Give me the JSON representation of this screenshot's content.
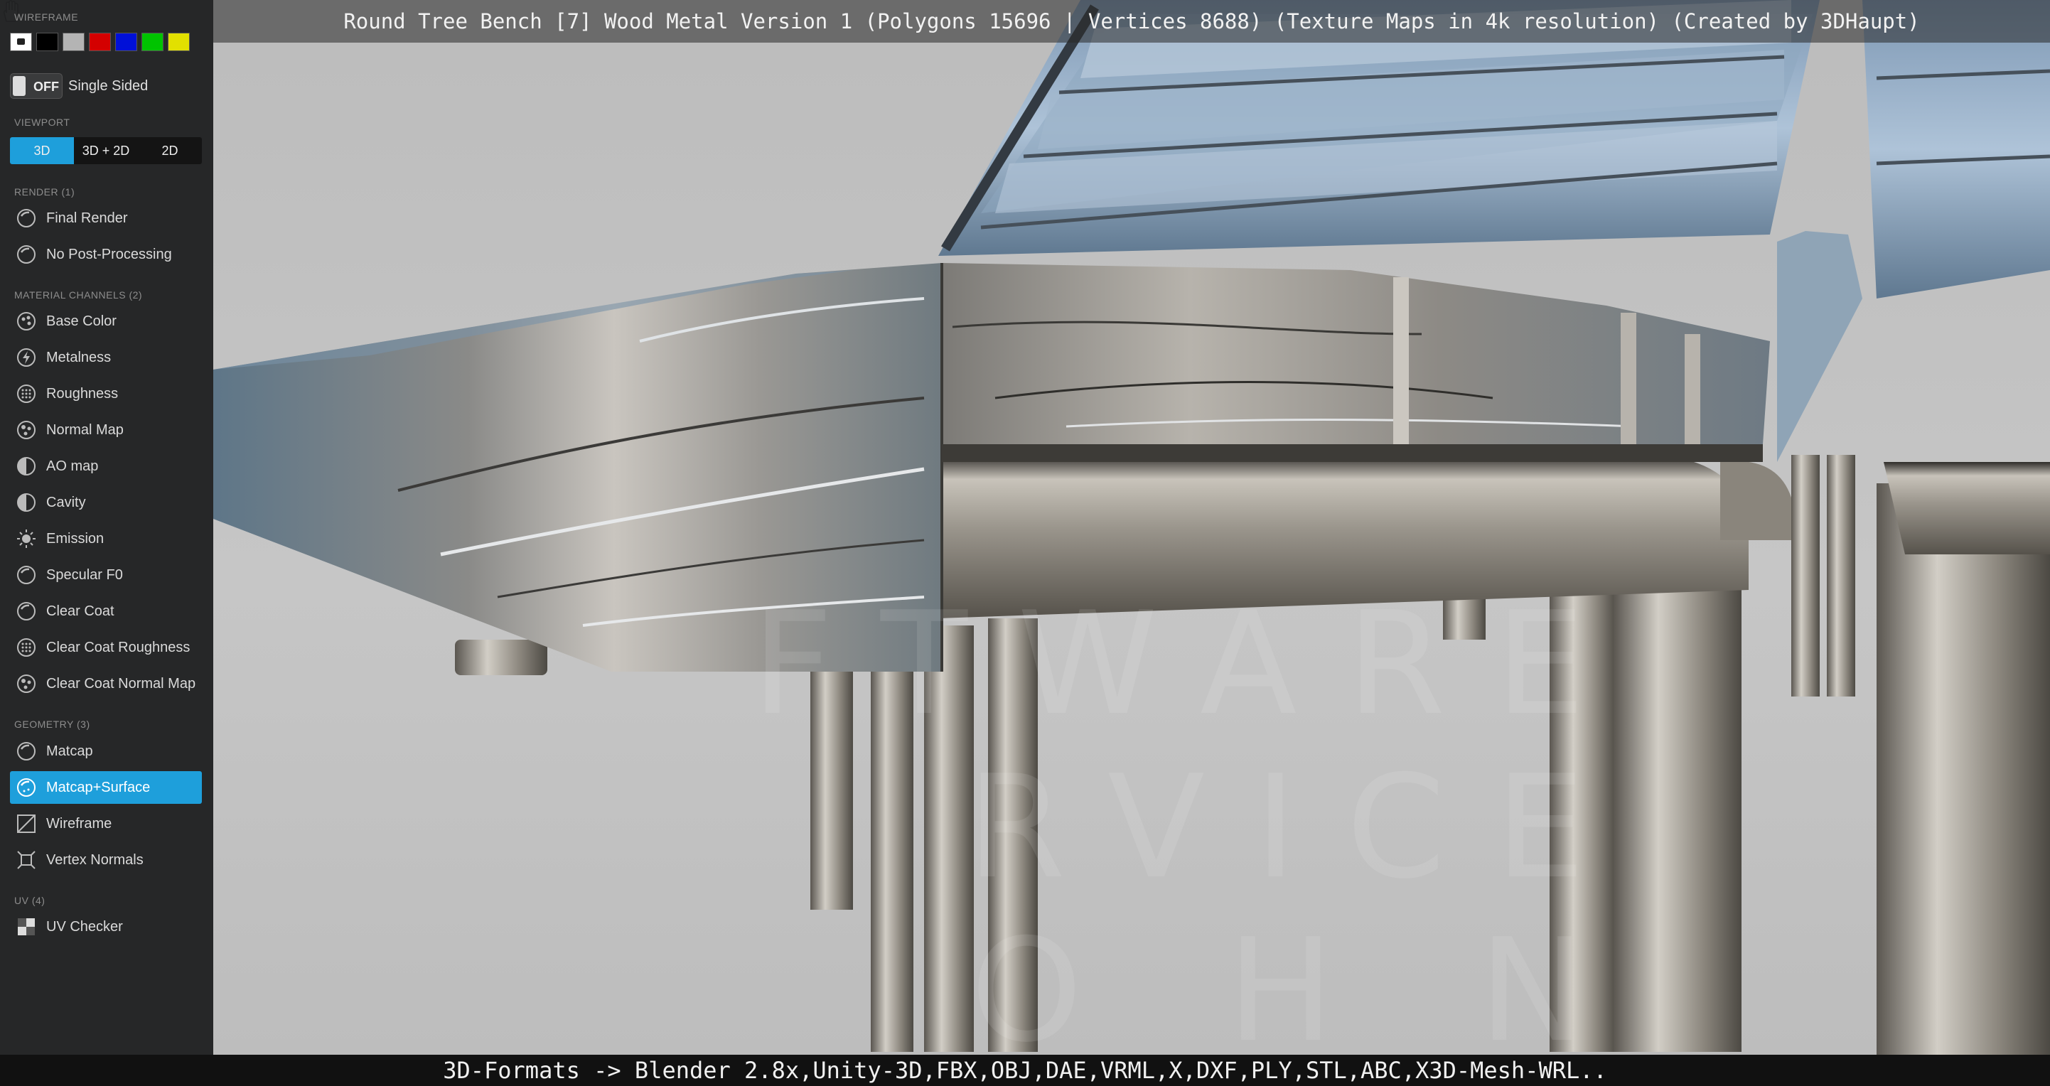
{
  "title": "Round Tree Bench [7] Wood Metal Version 1 (Polygons 15696 | Vertices 8688) (Texture Maps in 4k resolution) (Created by 3DHaupt)",
  "footer": "3D-Formats -> Blender 2.8x,Unity-3D,FBX,OBJ,DAE,VRML,X,DXF,PLY,STL,ABC,X3D-Mesh-WRL..",
  "watermark_lines": [
    "FTWARE",
    "RVICE",
    "O H N"
  ],
  "sidebar": {
    "wireframe_label": "WIREFRAME",
    "swatch_colors": [
      "#ffffff",
      "#000000",
      "#b4b4b4",
      "#d40000",
      "#0010d8",
      "#00c400",
      "#e2e000"
    ],
    "toggle": {
      "state": "OFF",
      "label": "Single Sided"
    },
    "viewport": {
      "label": "VIEWPORT",
      "options": [
        "3D",
        "3D + 2D",
        "2D"
      ],
      "selected": "3D"
    },
    "render": {
      "label": "RENDER (1)",
      "items": [
        "Final Render",
        "No Post-Processing"
      ]
    },
    "material": {
      "label": "MATERIAL CHANNELS (2)",
      "items": [
        "Base Color",
        "Metalness",
        "Roughness",
        "Normal Map",
        "AO map",
        "Cavity",
        "Emission",
        "Specular F0",
        "Clear Coat",
        "Clear Coat Roughness",
        "Clear Coat Normal Map"
      ]
    },
    "geometry": {
      "label": "GEOMETRY (3)",
      "items": [
        "Matcap",
        "Matcap+Surface",
        "Wireframe",
        "Vertex Normals"
      ],
      "selected": "Matcap+Surface"
    },
    "uv": {
      "label": "UV (4)",
      "items": [
        "UV Checker"
      ]
    },
    "accent_color": "#1e9fdb"
  }
}
